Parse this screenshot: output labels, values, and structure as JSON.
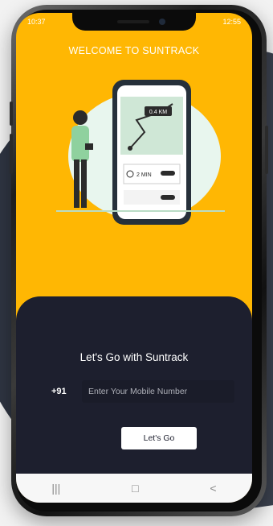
{
  "status": {
    "left": "10:37",
    "right": "12:55"
  },
  "welcome_title": "WELCOME TO SUNTRACK",
  "illustration": {
    "distance": "0.4 KM",
    "time": "2 MIN"
  },
  "login": {
    "heading": "Let's Go with Suntrack",
    "country_code": "+91",
    "phone_placeholder": "Enter Your Mobile Number",
    "submit_label": "Let's Go"
  },
  "nav": {
    "recent_icon": "recent-apps-icon",
    "home_icon": "home-icon",
    "back_icon": "back-icon"
  },
  "colors": {
    "accent": "#FFB703",
    "panel": "#1d1f2e"
  }
}
